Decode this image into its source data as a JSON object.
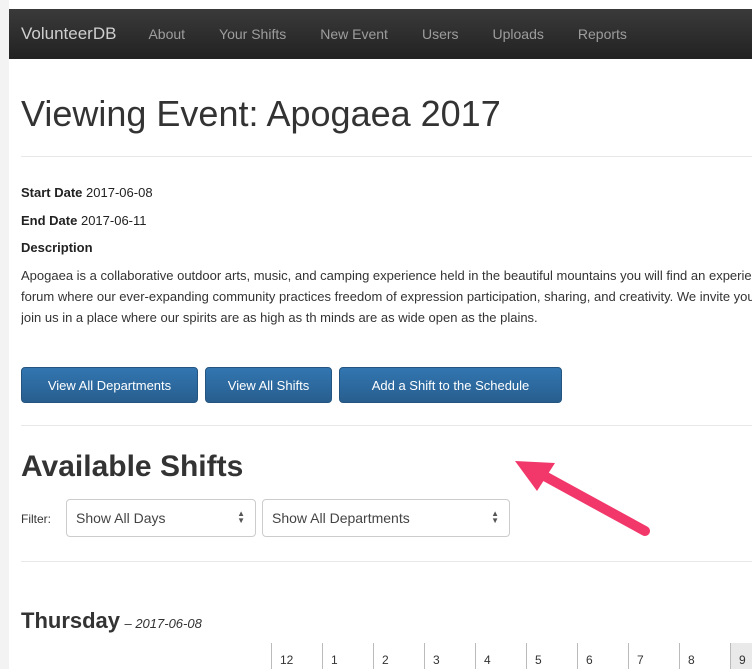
{
  "navbar": {
    "brand": "VolunteerDB",
    "items": [
      "About",
      "Your Shifts",
      "New Event",
      "Users",
      "Uploads",
      "Reports"
    ]
  },
  "event": {
    "title": "Viewing Event: Apogaea 2017",
    "start_label": "Start Date",
    "start_value": "2017-06-08",
    "end_label": "End Date",
    "end_value": "2017-06-11",
    "description_label": "Description",
    "description": "Apogaea is a collaborative outdoor arts, music, and camping experience held in the beautiful mountains you will find an experiential forum where our ever-expanding community practices freedom of expression participation, sharing, and creativity. We invite you to join us in a place where our spirits are as high as th minds are as wide open as the plains."
  },
  "buttons": {
    "view_departments": "View All Departments",
    "view_shifts": "View All Shifts",
    "add_shift": "Add a Shift to the Schedule"
  },
  "shifts": {
    "title": "Available Shifts",
    "filter_label": "Filter:",
    "days_select": "Show All Days",
    "departments_select": "Show All Departments"
  },
  "day": {
    "name": "Thursday",
    "date": "– 2017-06-08",
    "hours": [
      "12",
      "1",
      "2",
      "3",
      "4",
      "5",
      "6",
      "7",
      "8",
      "9"
    ]
  },
  "colors": {
    "navbar": "#222222",
    "primary_button": "#285e8e",
    "annotation_arrow": "#f2386b"
  }
}
